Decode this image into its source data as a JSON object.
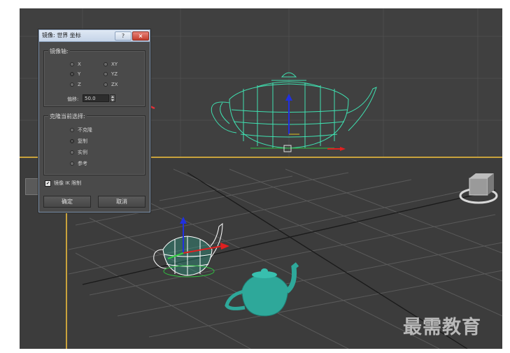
{
  "dialog": {
    "title": "镜像: 世界 坐标",
    "help_label": "?",
    "close_label": "×",
    "mirror_axis": {
      "label": "镜像轴:",
      "options": [
        "X",
        "Y",
        "Z",
        "XY",
        "YZ",
        "ZX"
      ],
      "selected": "Y"
    },
    "offset": {
      "label": "偏移:",
      "value": "50.0"
    },
    "clone_selection": {
      "label": "克隆当前选择:",
      "options": [
        "不克隆",
        "复制",
        "实例",
        "参考"
      ],
      "selected": "复制"
    },
    "mirror_ik": {
      "label": "镜像 IK 限制",
      "checked": true,
      "check_glyph": "✔"
    },
    "ok_label": "确定",
    "cancel_label": "取消"
  },
  "watermark": "最需教育",
  "colors": {
    "wireframe": "#3fe0b0",
    "teapot": "#2ea89a",
    "annotation_arrow": "#e0323a",
    "gizmo_y": "#2030e0",
    "gizmo_x": "#e02020",
    "viewport_border": "#c8a23c"
  }
}
